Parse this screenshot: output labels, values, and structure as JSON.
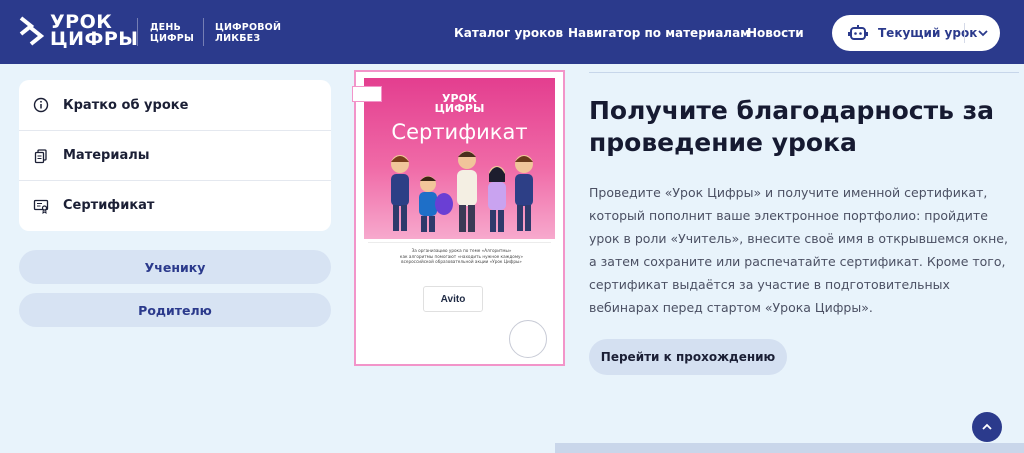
{
  "header": {
    "logo_line1": "УРОК",
    "logo_line2": "ЦИФРЫ",
    "sub1_line1": "ДЕНЬ",
    "sub1_line2": "ЦИФРЫ",
    "sub2_line1": "ЦИФРОВОЙ",
    "sub2_line2": "ЛИКБЕЗ",
    "nav": [
      "Каталог уроков",
      "Навигатор по материалам",
      "Новости"
    ],
    "current_lesson": "Текущий урок",
    "bg_color": "#2b3a8c"
  },
  "side_menu": {
    "items": [
      {
        "label": "Кратко об уроке",
        "icon": "info-icon"
      },
      {
        "label": "Материалы",
        "icon": "documents-icon"
      },
      {
        "label": "Сертификат",
        "icon": "certificate-icon"
      }
    ],
    "pills": [
      "Ученику",
      "Родителю"
    ]
  },
  "certificate": {
    "logo_line1": "УРОК",
    "logo_line2": "ЦИФРЫ",
    "title": "Сертификат",
    "text_line1": "За организацию урока по теме «Алгоритмы»",
    "text_line2": "как алгоритмы помогают «находить нужное каждому»",
    "text_line3": "всероссийской образовательной акции «Урок Цифры»",
    "partner": "Avito",
    "accent": "#e33e8f"
  },
  "main": {
    "heading": "Получите благодарность за проведение урока",
    "description": "Проведите «Урок Цифры» и получите именной сертификат, который пополнит ваше электронное портфолио: пройдите урок в роли «Учитель», внесите своё имя в открывшемся окне, а затем сохраните или распечатайте сертификат. Кроме того, сертификат выдаётся за участие в подготовительных вебинарах перед стартом «Урока Цифры».",
    "go_button": "Перейти к прохождению"
  }
}
